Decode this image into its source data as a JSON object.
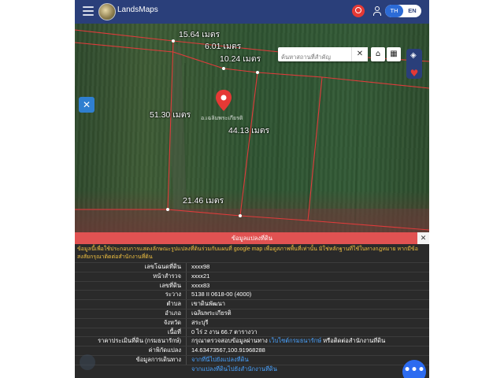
{
  "header": {
    "brand": "LandsMaps",
    "lang_th": "TH",
    "lang_en": "EN"
  },
  "map": {
    "search_placeholder": "ค้นหาสถานที่สำคัญ",
    "clear_label": "✕",
    "measurements": [
      "15.64 เมตร",
      "6.01 เมตร",
      "10.24 เมตร",
      "51.30 เมตร",
      "44.13 เมตร",
      "21.46 เมตร"
    ],
    "marker_color": "#e53935"
  },
  "panel": {
    "title": "ข้อมูลแปลงที่ดิน",
    "close_label": "✕",
    "notice": "ข้อมูลนี้เพื่อใช้ประกอบการแสดงลักษณะรูปแปลงที่ดินร่วมกับแผนที่ google map เพื่อดูสภาพพื้นที่เท่านั้น มิใช่หลักฐานที่ใช้ในทางกฎหมาย หากมีข้อสงสัยกรุณาติดต่อสำนักงานที่ดิน",
    "rows": [
      {
        "label": "เลขโฉนดที่ดิน",
        "value": "xxxx98"
      },
      {
        "label": "หน้าสำรวจ",
        "value": "xxxx21"
      },
      {
        "label": "เลขที่ดิน",
        "value": "xxxx83"
      },
      {
        "label": "ระวาง",
        "value": "5138 II 0618-00 (4000)"
      },
      {
        "label": "ตำบล",
        "value": "เขาดินพัฒนา"
      },
      {
        "label": "อำเภอ",
        "value": "เฉลิมพระเกียรติ"
      },
      {
        "label": "จังหวัด",
        "value": "สระบุรี"
      },
      {
        "label": "เนื้อที่",
        "value": "0 ไร่ 2 งาน 66.7 ตารางวา"
      }
    ],
    "price_label": "ราคาประเมินที่ดิน (กรมธนารักษ์)",
    "price_text_1": "กรุณาตรวจสอบข้อมูลผ่านทาง",
    "price_link": "เว็บไซต์กรมธนารักษ์",
    "price_text_2": "หรือติดต่อสำนักงานที่ดิน",
    "coords_label": "ค่าพิกัดแปลง",
    "coords_value": "14.63473567,100.91968288",
    "route_label": "ข้อมูลการเดินทาง",
    "route_link_1": "จากที่นี่ไปยังแปลงที่ดิน",
    "route_link_2": "จากแปลงที่ดินไปยังสำนักงานที่ดิน"
  },
  "fab_label": "•••"
}
